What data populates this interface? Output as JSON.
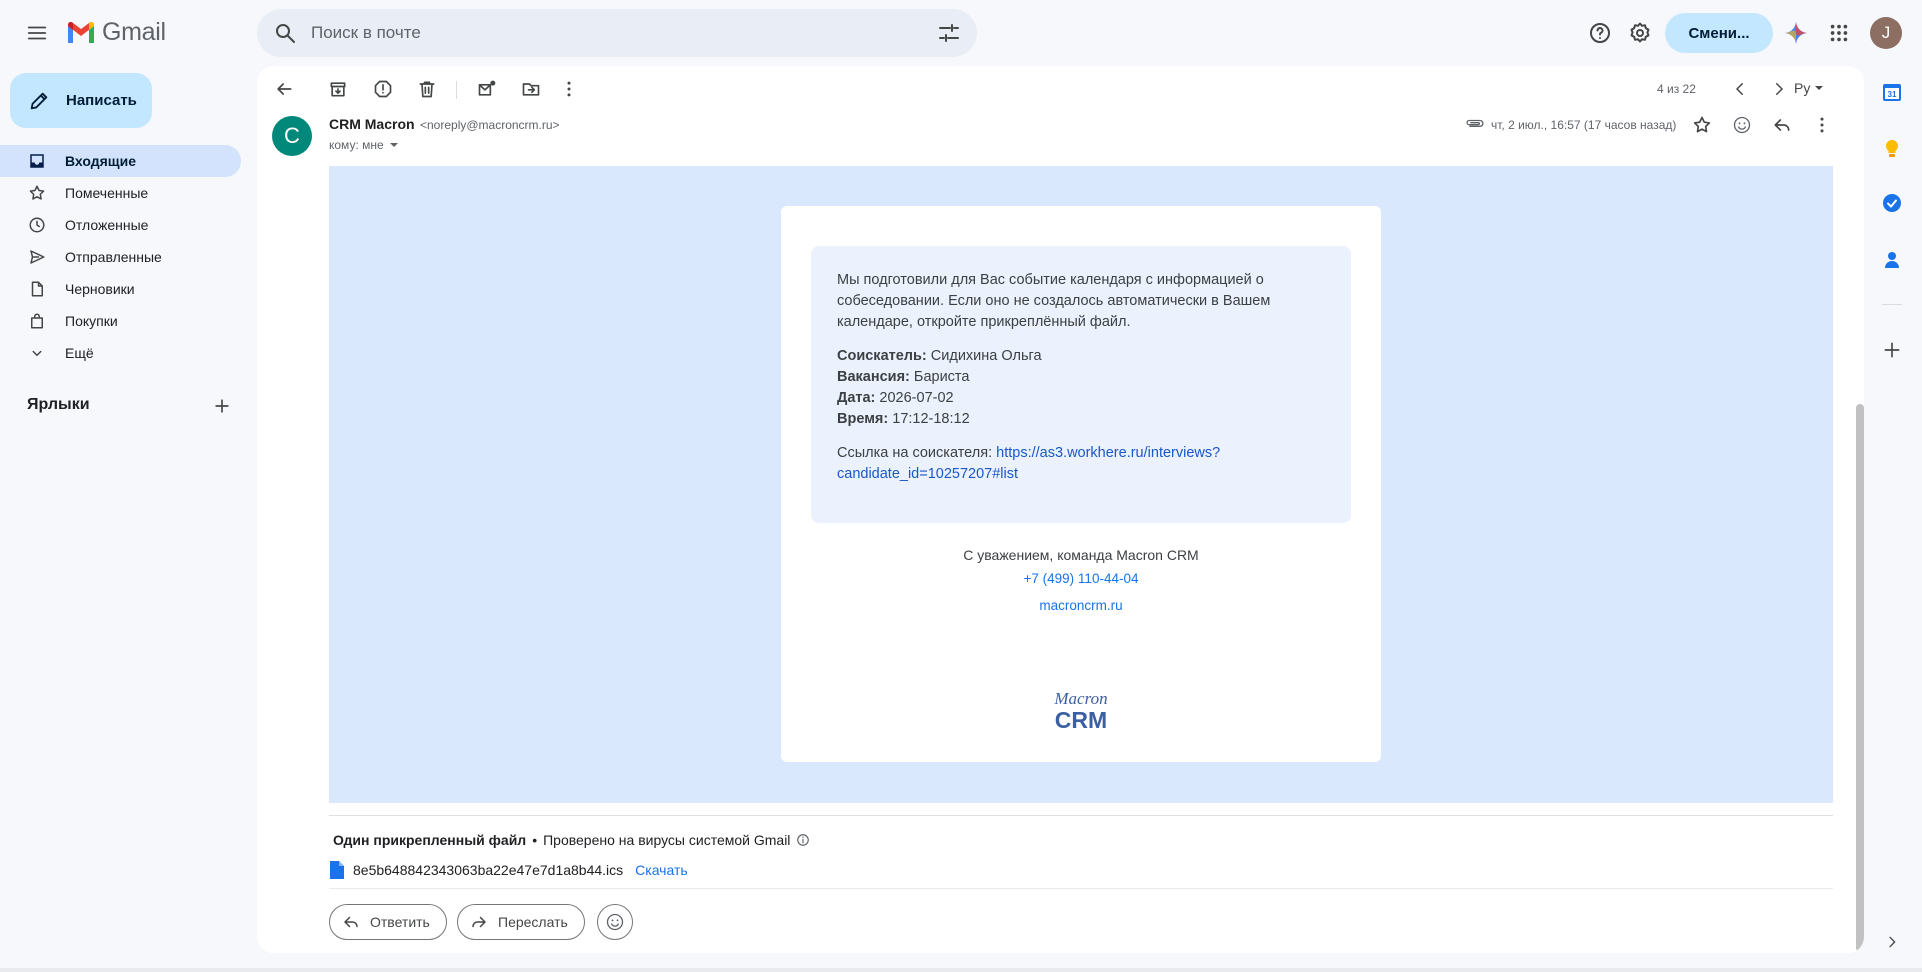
{
  "app": {
    "name": "Gmail"
  },
  "search": {
    "placeholder": "Поиск в почте"
  },
  "header": {
    "switch_label": "Смени...",
    "account_initial": "J"
  },
  "compose": {
    "label": "Написать"
  },
  "sidebar": {
    "items": [
      {
        "label": "Входящие",
        "icon": "inbox-icon",
        "active": true
      },
      {
        "label": "Помеченные",
        "icon": "star-icon"
      },
      {
        "label": "Отложенные",
        "icon": "clock-icon"
      },
      {
        "label": "Отправленные",
        "icon": "send-icon"
      },
      {
        "label": "Черновики",
        "icon": "draft-icon"
      },
      {
        "label": "Покупки",
        "icon": "shopping-bag-icon"
      },
      {
        "label": "Ещё",
        "icon": "chevron-down-icon"
      }
    ],
    "labels_heading": "Ярлыки"
  },
  "toolbar": {
    "pager": "4 из 22",
    "lang": "Ру"
  },
  "message": {
    "sender_initial": "C",
    "sender_name": "CRM Macron",
    "sender_email": "<noreply@macroncrm.ru>",
    "to": "кому: мне",
    "date": "чт, 2 июл., 16:57 (17 часов назад)",
    "intro": "Мы подготовили для Вас событие календаря с информацией о собеседовании. Если оно не создалось автоматически в Вашем календаре, откройте прикреплённый файл.",
    "fields": [
      {
        "label": "Соискатель:",
        "value": "Сидихина Ольга"
      },
      {
        "label": "Вакансия:",
        "value": "Бариста"
      },
      {
        "label": "Дата:",
        "value": "2026-07-02"
      },
      {
        "label": "Время:",
        "value": "17:12-18:12"
      }
    ],
    "link_prefix": "Ссылка на соискателя:",
    "link_line1": "https://as3.workhere.ru/interviews?",
    "link_line2": "candidate_id=10257207#list",
    "regards": "С уважением, команда Macron CRM",
    "phone": "+7 (499) 110-44-04",
    "site": "macroncrm.ru",
    "logo_line1": "Macron",
    "logo_line2": "CRM"
  },
  "attachments": {
    "title": "Один прикрепленный файл",
    "scan_note": "Проверено на вирусы системой Gmail",
    "filename": "8e5b648842343063ba22e47e7d1a8b44.ics",
    "download": "Скачать"
  },
  "actions": {
    "reply": "Ответить",
    "forward": "Переслать"
  },
  "colors": {
    "accent": "#1a73e8",
    "compose_bg": "#c2e7ff",
    "active_nav": "#d3e3fd",
    "email_bg": "#d9e8fd",
    "avatar": "#00897b"
  }
}
